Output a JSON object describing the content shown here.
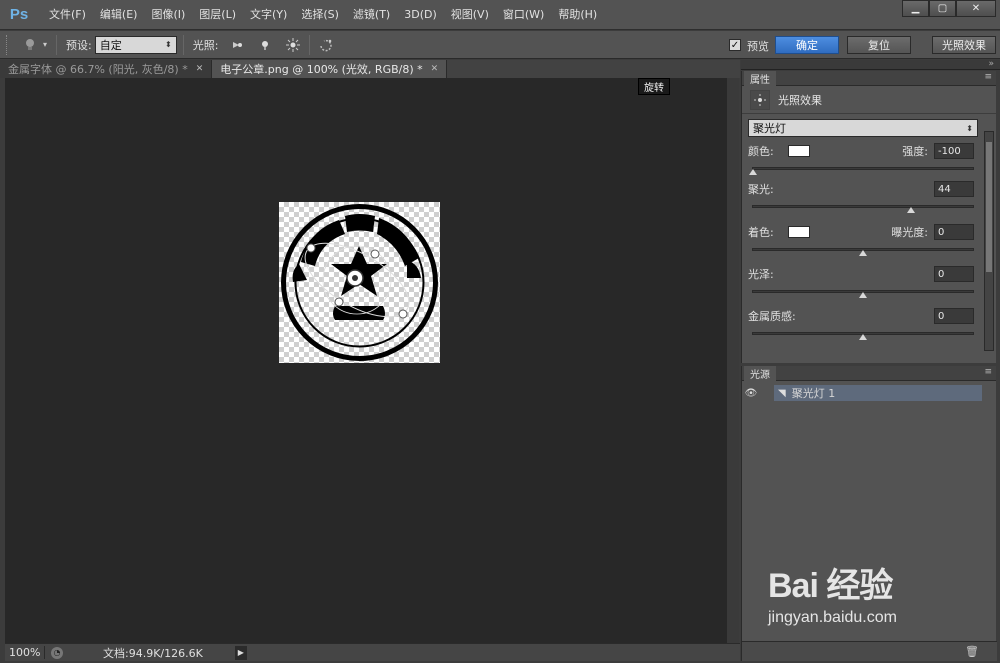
{
  "app": {
    "logo": "Ps",
    "menus": [
      "文件(F)",
      "编辑(E)",
      "图像(I)",
      "图层(L)",
      "文字(Y)",
      "选择(S)",
      "滤镜(T)",
      "3D(D)",
      "视图(V)",
      "窗口(W)",
      "帮助(H)"
    ],
    "window_controls": [
      "minimize-icon",
      "maximize-icon",
      "close-icon"
    ]
  },
  "options": {
    "preset_label": "预设:",
    "preset_value": "自定",
    "light_label": "光照:",
    "preview_label": "预览",
    "preview_checked": true,
    "ok_label": "确定",
    "reset_label": "复位",
    "lighting_effects_label": "光照效果"
  },
  "tabs": [
    {
      "label": "金属字体 @ 66.7% (阳光, 灰色/8) *",
      "active": false
    },
    {
      "label": "电子公章.png @ 100% (光效, RGB/8) *",
      "active": true
    }
  ],
  "canvas": {
    "tooltip": "旋转"
  },
  "status": {
    "zoom": "100%",
    "doc_info": "文档:94.9K/126.6K"
  },
  "properties": {
    "tab_label": "属性",
    "header_title": "光照效果",
    "light_type": "聚光灯",
    "color_label": "颜色:",
    "intensity_label": "强度:",
    "intensity_value": "-100",
    "intensity_level": 0.0,
    "hotspot_label": "聚光:",
    "hotspot_value": "44",
    "hotspot_level": 0.72,
    "colorize_label": "着色:",
    "exposure_label": "曝光度:",
    "exposure_value": "0",
    "exposure_level": 0.5,
    "gloss_label": "光泽:",
    "gloss_value": "0",
    "gloss_level": 0.5,
    "metallic_label": "金属质感:",
    "metallic_value": "0",
    "metallic_level": 0.5
  },
  "lights": {
    "tab_label": "光源",
    "items": [
      {
        "name": "聚光灯 1"
      }
    ]
  },
  "watermark": {
    "main": "Bai 经验",
    "sub": "jingyan.baidu.com"
  }
}
